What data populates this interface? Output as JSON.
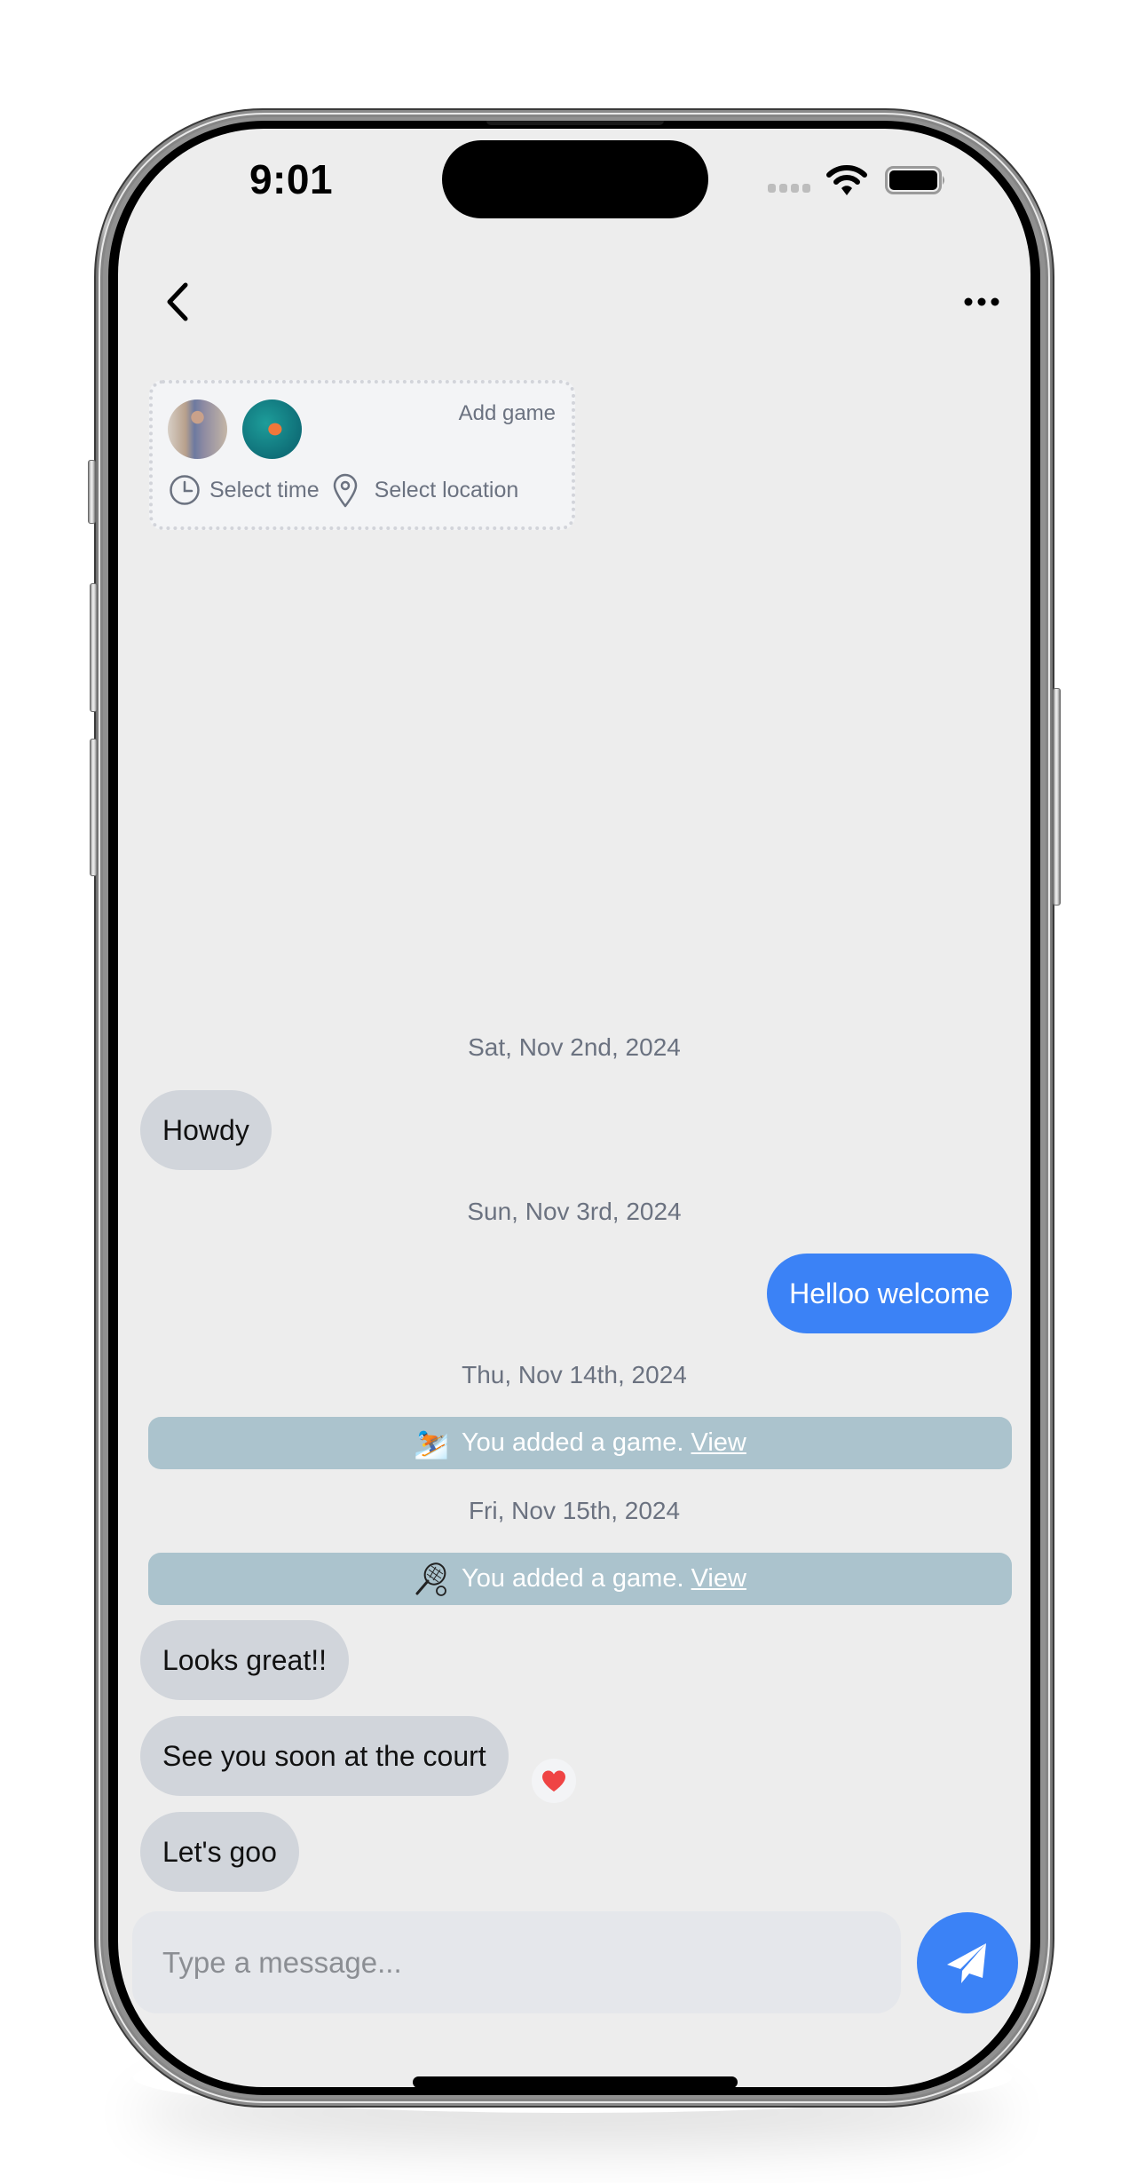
{
  "status_bar": {
    "time": "9:01",
    "signal_icon": "cellular-signal-icon",
    "wifi_icon": "wifi-icon",
    "battery_icon": "battery-icon"
  },
  "nav": {
    "back_icon": "chevron-left-icon",
    "more_icon": "ellipsis-icon"
  },
  "game_card": {
    "add_game_label": "Add game",
    "select_time_label": "Select time",
    "select_location_label": "Select location",
    "time_icon": "clock-icon",
    "location_icon": "map-pin-icon",
    "participants": [
      {
        "avatar": "avatar-man-standing"
      },
      {
        "avatar": "avatar-woman-swimming"
      }
    ]
  },
  "messages": {
    "dates": [
      "Sat, Nov 2nd, 2024",
      "Sun, Nov 3rd, 2024",
      "Thu, Nov 14th, 2024",
      "Fri, Nov 15th, 2024"
    ],
    "items": [
      {
        "type": "incoming",
        "text": "Howdy"
      },
      {
        "type": "outgoing",
        "text": "Helloo welcome"
      },
      {
        "type": "system",
        "emoji": "⛷️",
        "text": "You added a game.",
        "link": "View"
      },
      {
        "type": "system",
        "emoji": "🎾",
        "text": "You added a game.",
        "link": "View"
      },
      {
        "type": "incoming",
        "text": "Looks great!!"
      },
      {
        "type": "incoming",
        "text": "See you soon at the court",
        "reaction": "❤️"
      },
      {
        "type": "incoming",
        "text": "Let's goo"
      }
    ]
  },
  "composer": {
    "placeholder": "Type a message...",
    "value": "",
    "send_icon": "paper-plane-icon"
  },
  "colors": {
    "screen_bg": "#ededed",
    "outgoing_bubble": "#3b82f6",
    "incoming_bubble": "#d1d5db",
    "system_banner": "#abc3cd",
    "muted_text": "#6b7280",
    "heart": "#ef4444"
  }
}
